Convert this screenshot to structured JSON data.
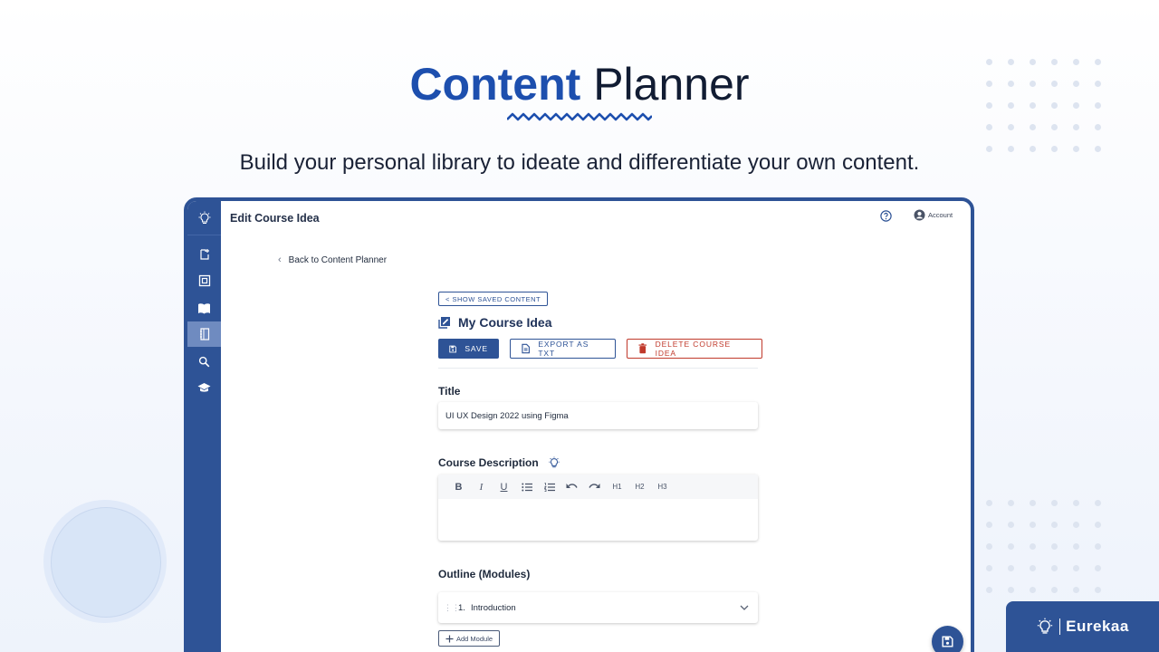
{
  "hero": {
    "title_strong": "Content",
    "title_light": "Planner",
    "subtitle": "Build your personal library to ideate and differentiate your own content."
  },
  "app": {
    "page_title": "Edit Course Idea",
    "account_label": "Account",
    "back_link": "Back to Content Planner",
    "show_saved": "< SHOW SAVED CONTENT",
    "course_heading": "My Course Idea",
    "actions": {
      "save": "SAVE",
      "export": "EXPORT AS TXT",
      "delete": "DELETE COURSE IDEA"
    },
    "title_label": "Title",
    "title_value": "UI UX Design 2022 using Figma",
    "description_label": "Course Description",
    "editor_toolbar": [
      "B",
      "I",
      "U",
      "bullet-list",
      "numbered-list",
      "undo",
      "redo",
      "H1",
      "H2",
      "H3"
    ],
    "outline_label": "Outline (Modules)",
    "modules": [
      {
        "number": "1.",
        "name": "Introduction"
      }
    ],
    "add_module": "Add Module"
  },
  "sidebar": {
    "icons": [
      "bulb-icon",
      "new-document-icon",
      "scan-icon",
      "book-open-icon",
      "notebook-icon",
      "search-icon",
      "graduation-cap-icon"
    ],
    "active_index": 4
  },
  "brand": {
    "name": "Eurekaa"
  },
  "colors": {
    "primary": "#2e5396",
    "accent_blue": "#1d4fae",
    "danger": "#c0392b",
    "active_sidebar": "#6f8bc0"
  }
}
